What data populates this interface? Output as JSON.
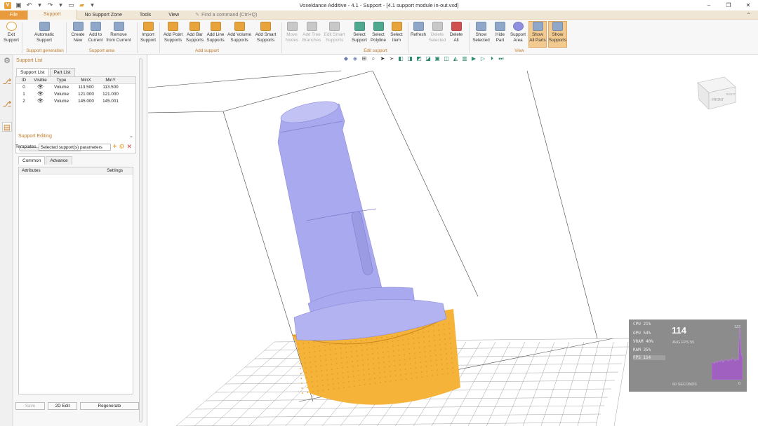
{
  "window": {
    "title": "Voxeldance Additive - 4.1 - Support - [4.1 support module in-out.vxd]",
    "minimize": "–",
    "maximize": "❐",
    "close": "✕"
  },
  "menu": {
    "file": "File",
    "support": "Support",
    "no_support_zone": "No Support Zone",
    "tools": "Tools",
    "view": "View",
    "command_placeholder": "Find a command (Ctrl+Q)"
  },
  "ribbon": {
    "buttons": [
      {
        "l1": "Exit",
        "l2": "Support",
        "color": "#e8a33a"
      },
      {
        "l1": "Automatic",
        "l2": "Support",
        "color": "#8fa7c9"
      },
      {
        "l1": "Create",
        "l2": "New",
        "color": "#8fa7c9"
      },
      {
        "l1": "Add to",
        "l2": "Current",
        "color": "#8fa7c9"
      },
      {
        "l1": "Remove",
        "l2": "from Current",
        "color": "#8fa7c9"
      },
      {
        "l1": "Import",
        "l2": "Support",
        "color": "#e8a33a"
      },
      {
        "l1": "Add Point",
        "l2": "Supports",
        "color": "#e8a33a"
      },
      {
        "l1": "Add Bar",
        "l2": "Supports",
        "color": "#e8a33a"
      },
      {
        "l1": "Add Line",
        "l2": "Supports",
        "color": "#e8a33a"
      },
      {
        "l1": "Add Volume",
        "l2": "Supports",
        "color": "#e8a33a"
      },
      {
        "l1": "Add Smart",
        "l2": "Supports",
        "color": "#e8a33a"
      },
      {
        "l1": "Move",
        "l2": "Nodes",
        "color": "#c8c8c8"
      },
      {
        "l1": "Add Tree",
        "l2": "Branches",
        "color": "#c8c8c8"
      },
      {
        "l1": "Edit Smart",
        "l2": "Supports",
        "color": "#c8c8c8"
      },
      {
        "l1": "Select",
        "l2": "Support",
        "color": "#4fa890"
      },
      {
        "l1": "Select",
        "l2": "Polyline",
        "color": "#4fa890"
      },
      {
        "l1": "Select",
        "l2": "Item",
        "color": "#e8a33a"
      },
      {
        "l1": "Refresh",
        "l2": "",
        "color": "#8fa7c9"
      },
      {
        "l1": "Delete",
        "l2": "Selected",
        "color": "#c8c8c8"
      },
      {
        "l1": "Delete",
        "l2": "All",
        "color": "#d05050"
      },
      {
        "l1": "Show",
        "l2": "Selected",
        "color": "#8fa7c9"
      },
      {
        "l1": "Hide",
        "l2": "Part",
        "color": "#8fa7c9"
      },
      {
        "l1": "Support",
        "l2": "Area",
        "color": "#8f90e0"
      },
      {
        "l1": "Show",
        "l2": "All Parts",
        "color": "#8fa7c9"
      },
      {
        "l1": "Show",
        "l2": "Supports",
        "color": "#8fa7c9"
      }
    ],
    "groups": [
      "Support generation",
      "Support area",
      "Add support",
      "Edit support",
      "View"
    ]
  },
  "panel": {
    "support_list_title": "Support List",
    "tabs": [
      "Support List",
      "Part List"
    ],
    "columns": [
      "ID",
      "Visible",
      "Type",
      "MinX",
      "MinY"
    ],
    "rows": [
      {
        "id": "0",
        "type": "Volume",
        "minx": "113.500",
        "miny": "113.500"
      },
      {
        "id": "1",
        "type": "Volume",
        "minx": "121.000",
        "miny": "121.000"
      },
      {
        "id": "2",
        "type": "Volume",
        "minx": "145.000",
        "miny": "145.001"
      }
    ],
    "support_editing_title": "Support Editing",
    "templates_label": "Templates",
    "templates_value": "Selected support(s) parameters",
    "edit_tabs": [
      "Common",
      "Advance"
    ],
    "attr_columns": [
      "Attributes",
      "Settings"
    ],
    "buttons": {
      "save": "Save",
      "edit2d": "2D Edit",
      "regenerate": "Regenerate"
    }
  },
  "viewcube": {
    "front": "FRONT",
    "right": "RIGHT"
  },
  "perf": {
    "cpu": "CPU 21%",
    "gpu": "GPU 54%",
    "vram": "VRAM 40%",
    "ram": "RAM 35%",
    "fps": "FPS 114",
    "current": "114",
    "avg": "AVG FPS 55",
    "max": "122",
    "min": "0",
    "window": "60 SECONDS",
    "history": [
      38,
      40,
      37,
      42,
      39,
      44,
      41,
      46,
      40,
      43,
      47,
      45,
      42,
      48,
      44,
      50,
      46,
      43,
      49,
      45,
      122,
      60,
      52
    ]
  },
  "colors": {
    "accent": "#e8a33a",
    "part": "#a8a8ee",
    "support": "#f5b33a",
    "panel_title": "#c07a2a"
  }
}
